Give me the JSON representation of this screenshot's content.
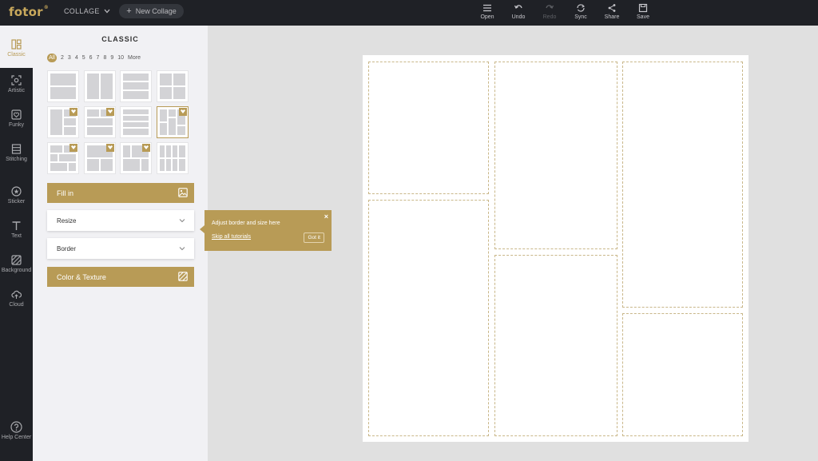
{
  "topbar": {
    "logo": "fotor",
    "logo_mark": "®",
    "mode": "COLLAGE",
    "new_collage": "New Collage",
    "actions": [
      {
        "label": "Open",
        "icon": "menu-icon",
        "enabled": true
      },
      {
        "label": "Undo",
        "icon": "undo-icon",
        "enabled": true
      },
      {
        "label": "Redo",
        "icon": "redo-icon",
        "enabled": false
      },
      {
        "label": "Sync",
        "icon": "sync-icon",
        "enabled": true
      },
      {
        "label": "Share",
        "icon": "share-icon",
        "enabled": true
      },
      {
        "label": "Save",
        "icon": "save-icon",
        "enabled": true
      }
    ]
  },
  "nav": {
    "items": [
      {
        "label": "Classic",
        "icon": "classic-layout-icon",
        "active": true
      },
      {
        "label": "Artistic",
        "icon": "artistic-icon"
      },
      {
        "label": "Funky",
        "icon": "funky-heart-icon"
      },
      {
        "label": "Stitching",
        "icon": "stitching-icon"
      },
      {
        "label": "Sticker",
        "icon": "sticker-icon"
      },
      {
        "label": "Text",
        "icon": "text-icon"
      },
      {
        "label": "Background",
        "icon": "background-icon"
      },
      {
        "label": "Cloud",
        "icon": "cloud-icon"
      }
    ],
    "help": "Help Center"
  },
  "panel": {
    "title": "CLASSIC",
    "filters": [
      "All",
      "2",
      "3",
      "4",
      "5",
      "6",
      "7",
      "8",
      "9",
      "10",
      "More"
    ],
    "fill_in": "Fill in",
    "resize": "Resize",
    "border": "Border",
    "color_texture": "Color & Texture"
  },
  "tooltip": {
    "text": "Adjust border and size here",
    "skip": "Skip all tutorials",
    "got_it": "Got it",
    "close": "×"
  },
  "colors": {
    "accent": "#b89b56",
    "topbar": "#1f2126",
    "panel": "#f1f1f4"
  }
}
